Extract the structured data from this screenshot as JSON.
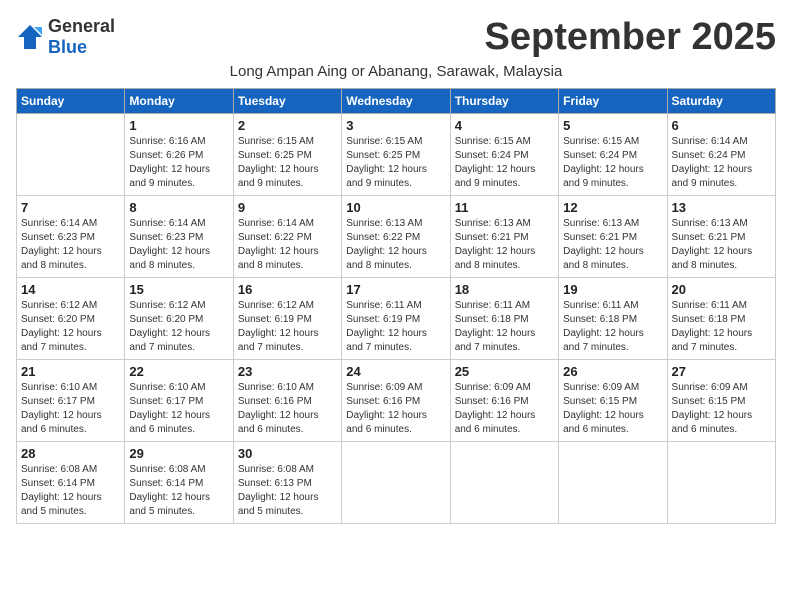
{
  "logo": {
    "general": "General",
    "blue": "Blue"
  },
  "title": "September 2025",
  "subtitle": "Long Ampan Aing or Abanang, Sarawak, Malaysia",
  "days_of_week": [
    "Sunday",
    "Monday",
    "Tuesday",
    "Wednesday",
    "Thursday",
    "Friday",
    "Saturday"
  ],
  "weeks": [
    [
      {
        "day": "",
        "info": ""
      },
      {
        "day": "1",
        "info": "Sunrise: 6:16 AM\nSunset: 6:26 PM\nDaylight: 12 hours\nand 9 minutes."
      },
      {
        "day": "2",
        "info": "Sunrise: 6:15 AM\nSunset: 6:25 PM\nDaylight: 12 hours\nand 9 minutes."
      },
      {
        "day": "3",
        "info": "Sunrise: 6:15 AM\nSunset: 6:25 PM\nDaylight: 12 hours\nand 9 minutes."
      },
      {
        "day": "4",
        "info": "Sunrise: 6:15 AM\nSunset: 6:24 PM\nDaylight: 12 hours\nand 9 minutes."
      },
      {
        "day": "5",
        "info": "Sunrise: 6:15 AM\nSunset: 6:24 PM\nDaylight: 12 hours\nand 9 minutes."
      },
      {
        "day": "6",
        "info": "Sunrise: 6:14 AM\nSunset: 6:24 PM\nDaylight: 12 hours\nand 9 minutes."
      }
    ],
    [
      {
        "day": "7",
        "info": "Sunrise: 6:14 AM\nSunset: 6:23 PM\nDaylight: 12 hours\nand 8 minutes."
      },
      {
        "day": "8",
        "info": "Sunrise: 6:14 AM\nSunset: 6:23 PM\nDaylight: 12 hours\nand 8 minutes."
      },
      {
        "day": "9",
        "info": "Sunrise: 6:14 AM\nSunset: 6:22 PM\nDaylight: 12 hours\nand 8 minutes."
      },
      {
        "day": "10",
        "info": "Sunrise: 6:13 AM\nSunset: 6:22 PM\nDaylight: 12 hours\nand 8 minutes."
      },
      {
        "day": "11",
        "info": "Sunrise: 6:13 AM\nSunset: 6:21 PM\nDaylight: 12 hours\nand 8 minutes."
      },
      {
        "day": "12",
        "info": "Sunrise: 6:13 AM\nSunset: 6:21 PM\nDaylight: 12 hours\nand 8 minutes."
      },
      {
        "day": "13",
        "info": "Sunrise: 6:13 AM\nSunset: 6:21 PM\nDaylight: 12 hours\nand 8 minutes."
      }
    ],
    [
      {
        "day": "14",
        "info": "Sunrise: 6:12 AM\nSunset: 6:20 PM\nDaylight: 12 hours\nand 7 minutes."
      },
      {
        "day": "15",
        "info": "Sunrise: 6:12 AM\nSunset: 6:20 PM\nDaylight: 12 hours\nand 7 minutes."
      },
      {
        "day": "16",
        "info": "Sunrise: 6:12 AM\nSunset: 6:19 PM\nDaylight: 12 hours\nand 7 minutes."
      },
      {
        "day": "17",
        "info": "Sunrise: 6:11 AM\nSunset: 6:19 PM\nDaylight: 12 hours\nand 7 minutes."
      },
      {
        "day": "18",
        "info": "Sunrise: 6:11 AM\nSunset: 6:18 PM\nDaylight: 12 hours\nand 7 minutes."
      },
      {
        "day": "19",
        "info": "Sunrise: 6:11 AM\nSunset: 6:18 PM\nDaylight: 12 hours\nand 7 minutes."
      },
      {
        "day": "20",
        "info": "Sunrise: 6:11 AM\nSunset: 6:18 PM\nDaylight: 12 hours\nand 7 minutes."
      }
    ],
    [
      {
        "day": "21",
        "info": "Sunrise: 6:10 AM\nSunset: 6:17 PM\nDaylight: 12 hours\nand 6 minutes."
      },
      {
        "day": "22",
        "info": "Sunrise: 6:10 AM\nSunset: 6:17 PM\nDaylight: 12 hours\nand 6 minutes."
      },
      {
        "day": "23",
        "info": "Sunrise: 6:10 AM\nSunset: 6:16 PM\nDaylight: 12 hours\nand 6 minutes."
      },
      {
        "day": "24",
        "info": "Sunrise: 6:09 AM\nSunset: 6:16 PM\nDaylight: 12 hours\nand 6 minutes."
      },
      {
        "day": "25",
        "info": "Sunrise: 6:09 AM\nSunset: 6:16 PM\nDaylight: 12 hours\nand 6 minutes."
      },
      {
        "day": "26",
        "info": "Sunrise: 6:09 AM\nSunset: 6:15 PM\nDaylight: 12 hours\nand 6 minutes."
      },
      {
        "day": "27",
        "info": "Sunrise: 6:09 AM\nSunset: 6:15 PM\nDaylight: 12 hours\nand 6 minutes."
      }
    ],
    [
      {
        "day": "28",
        "info": "Sunrise: 6:08 AM\nSunset: 6:14 PM\nDaylight: 12 hours\nand 5 minutes."
      },
      {
        "day": "29",
        "info": "Sunrise: 6:08 AM\nSunset: 6:14 PM\nDaylight: 12 hours\nand 5 minutes."
      },
      {
        "day": "30",
        "info": "Sunrise: 6:08 AM\nSunset: 6:13 PM\nDaylight: 12 hours\nand 5 minutes."
      },
      {
        "day": "",
        "info": ""
      },
      {
        "day": "",
        "info": ""
      },
      {
        "day": "",
        "info": ""
      },
      {
        "day": "",
        "info": ""
      }
    ]
  ]
}
